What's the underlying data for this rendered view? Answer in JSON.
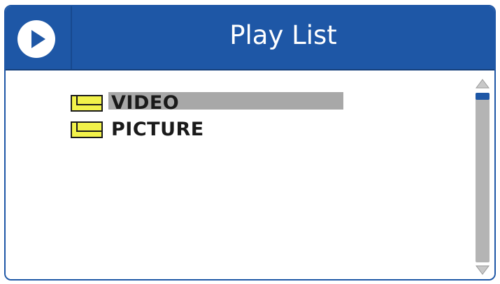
{
  "window": {
    "title": "Play List"
  },
  "icons": {
    "play": "play-circle-icon",
    "folder": "folder-icon",
    "scroll_up": "triangle-up-icon",
    "scroll_down": "triangle-down-icon"
  },
  "list": {
    "items": [
      {
        "label": "VIDEO",
        "selected": true
      },
      {
        "label": "PICTURE",
        "selected": false
      }
    ]
  },
  "colors": {
    "title_bar": "#1e57a6",
    "selection": "#a8a8a8",
    "folder_fill": "#f2f24a",
    "scroll_thumb": "#1e57a6"
  }
}
